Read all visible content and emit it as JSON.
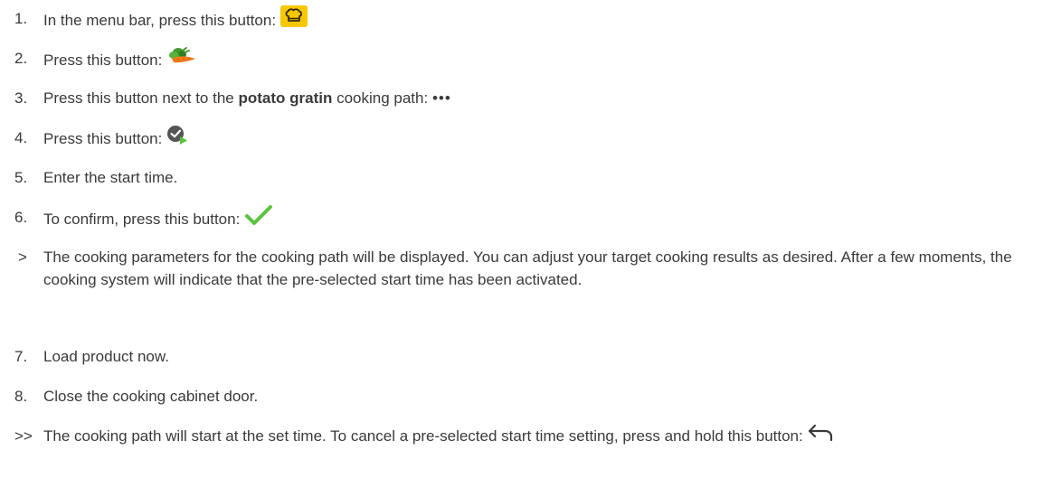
{
  "steps": [
    {
      "marker": "1.",
      "text": "In the menu bar, press this button: ",
      "icon": "chef-hat-icon"
    },
    {
      "marker": "2.",
      "text": "Press this button: ",
      "icon": "vegetables-icon"
    },
    {
      "marker": "3.",
      "text_before": "Press this button next to the ",
      "bold": "potato gratin",
      "text_after": " cooking path: ",
      "icon": "more-dots-icon",
      "icon_text": "•••"
    },
    {
      "marker": "4.",
      "text": "Press this button: ",
      "icon": "clock-start-icon"
    },
    {
      "marker": "5.",
      "text": "Enter the start time."
    },
    {
      "marker": "6.",
      "text": "To confirm, press this button: ",
      "icon": "checkmark-icon"
    },
    {
      "marker": ">",
      "text": "The cooking parameters for the cooking path will be displayed. You can adjust your target cooking results as desired. After a few moments, the cooking system will indicate that the pre-selected start time has been activated."
    },
    {
      "marker": "7.",
      "text": "Load product now."
    },
    {
      "marker": "8.",
      "text": "Close the cooking cabinet door."
    },
    {
      "marker": ">>",
      "text": "The cooking path will start at the set time. To cancel a pre-selected start time setting, press and hold this button: ",
      "icon": "back-arrow-icon"
    }
  ],
  "colors": {
    "text": "#3a3a3a",
    "menu_button_bg": "#f7c800",
    "check_green": "#5cc33e",
    "carrot_orange": "#f07a1c",
    "leaf_green": "#3f9a2e"
  }
}
